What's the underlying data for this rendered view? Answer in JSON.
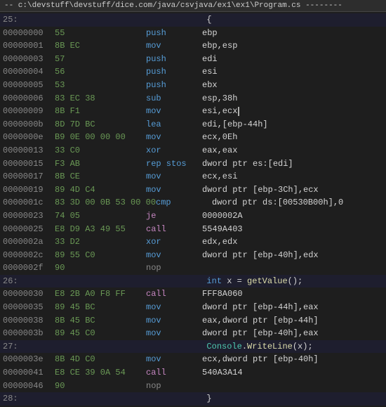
{
  "header": {
    "text": "-- c:\\devstuff\\devstuff/dice.com/java/csvjava/ex1\\ex1\\Program.cs --------"
  },
  "lines": [
    {
      "type": "src",
      "lineno": "25:",
      "indent": "            ",
      "code": "{",
      "classes": ""
    },
    {
      "type": "asm",
      "addr": "00000000",
      "bytes": "55",
      "mnem": "push",
      "ops": "ebp"
    },
    {
      "type": "asm",
      "addr": "00000001",
      "bytes": "8B EC",
      "mnem": "mov",
      "ops": "ebp,esp"
    },
    {
      "type": "asm",
      "addr": "00000003",
      "bytes": "57",
      "mnem": "push",
      "ops": "edi"
    },
    {
      "type": "asm",
      "addr": "00000004",
      "bytes": "56",
      "mnem": "push",
      "ops": "esi"
    },
    {
      "type": "asm",
      "addr": "00000005",
      "bytes": "53",
      "mnem": "push",
      "ops": "ebx"
    },
    {
      "type": "asm",
      "addr": "00000006",
      "bytes": "83 EC 38",
      "mnem": "sub",
      "ops": "esp,38h"
    },
    {
      "type": "asm",
      "addr": "00000009",
      "bytes": "8B F1",
      "mnem": "mov",
      "ops": "esi,ecx",
      "cursor": true
    },
    {
      "type": "asm",
      "addr": "0000000b",
      "bytes": "8D 7D BC",
      "mnem": "lea",
      "ops": "edi,[ebp-44h]"
    },
    {
      "type": "asm",
      "addr": "0000000e",
      "bytes": "B9 0E 00 00 00",
      "mnem": "mov",
      "ops": "ecx,0Eh"
    },
    {
      "type": "asm",
      "addr": "00000013",
      "bytes": "33 C0",
      "mnem": "xor",
      "ops": "eax,eax"
    },
    {
      "type": "asm",
      "addr": "00000015",
      "bytes": "F3 AB",
      "mnem": "rep stos",
      "ops": "dword ptr es:[edi]"
    },
    {
      "type": "asm",
      "addr": "00000017",
      "bytes": "8B CE",
      "mnem": "mov",
      "ops": "ecx,esi"
    },
    {
      "type": "asm",
      "addr": "00000019",
      "bytes": "89 4D C4",
      "mnem": "mov",
      "ops": "dword ptr [ebp-3Ch],ecx"
    },
    {
      "type": "asm",
      "addr": "0000001c",
      "bytes": "83 3D 00 0B 53 00 00",
      "mnem": "cmp",
      "ops": "dword ptr ds:[00530B00h],0"
    },
    {
      "type": "asm",
      "addr": "00000023",
      "bytes": "74 05",
      "mnem": "je",
      "ops": "0000002A"
    },
    {
      "type": "asm",
      "addr": "00000025",
      "bytes": "E8 D9 A3 49 55",
      "mnem": "call",
      "ops": "5549A403"
    },
    {
      "type": "asm",
      "addr": "0000002a",
      "bytes": "33 D2",
      "mnem": "xor",
      "ops": "edx,edx"
    },
    {
      "type": "asm",
      "addr": "0000002c",
      "bytes": "89 55 C0",
      "mnem": "mov",
      "ops": "dword ptr [ebp-40h],edx"
    },
    {
      "type": "asm",
      "addr": "0000002f",
      "bytes": "90",
      "mnem": "nop",
      "ops": ""
    },
    {
      "type": "src",
      "lineno": "26:",
      "indent": "            ",
      "code": "int x = getValue();",
      "classes": "src-line"
    },
    {
      "type": "asm",
      "addr": "00000030",
      "bytes": "E8 2B A0 F8 FF",
      "mnem": "call",
      "ops": "FFF8A060"
    },
    {
      "type": "asm",
      "addr": "00000035",
      "bytes": "89 45 BC",
      "mnem": "mov",
      "ops": "dword ptr [ebp-44h],eax"
    },
    {
      "type": "asm",
      "addr": "00000038",
      "bytes": "8B 45 BC",
      "mnem": "mov",
      "ops": "eax,dword ptr [ebp-44h]"
    },
    {
      "type": "asm",
      "addr": "0000003b",
      "bytes": "89 45 C0",
      "mnem": "mov",
      "ops": "dword ptr [ebp-40h],eax"
    },
    {
      "type": "src",
      "lineno": "27:",
      "indent": "            ",
      "code": "Console.WriteLine(x);",
      "classes": "src-line"
    },
    {
      "type": "asm",
      "addr": "0000003e",
      "bytes": "8B 4D C0",
      "mnem": "mov",
      "ops": "ecx,dword ptr [ebp-40h]"
    },
    {
      "type": "asm",
      "addr": "00000041",
      "bytes": "E8 CE 39 0A 54",
      "mnem": "call",
      "ops": "540A3A14"
    },
    {
      "type": "asm",
      "addr": "00000046",
      "bytes": "90",
      "mnem": "nop",
      "ops": ""
    },
    {
      "type": "src",
      "lineno": "28:",
      "indent": "            ",
      "code": "}",
      "classes": ""
    }
  ]
}
